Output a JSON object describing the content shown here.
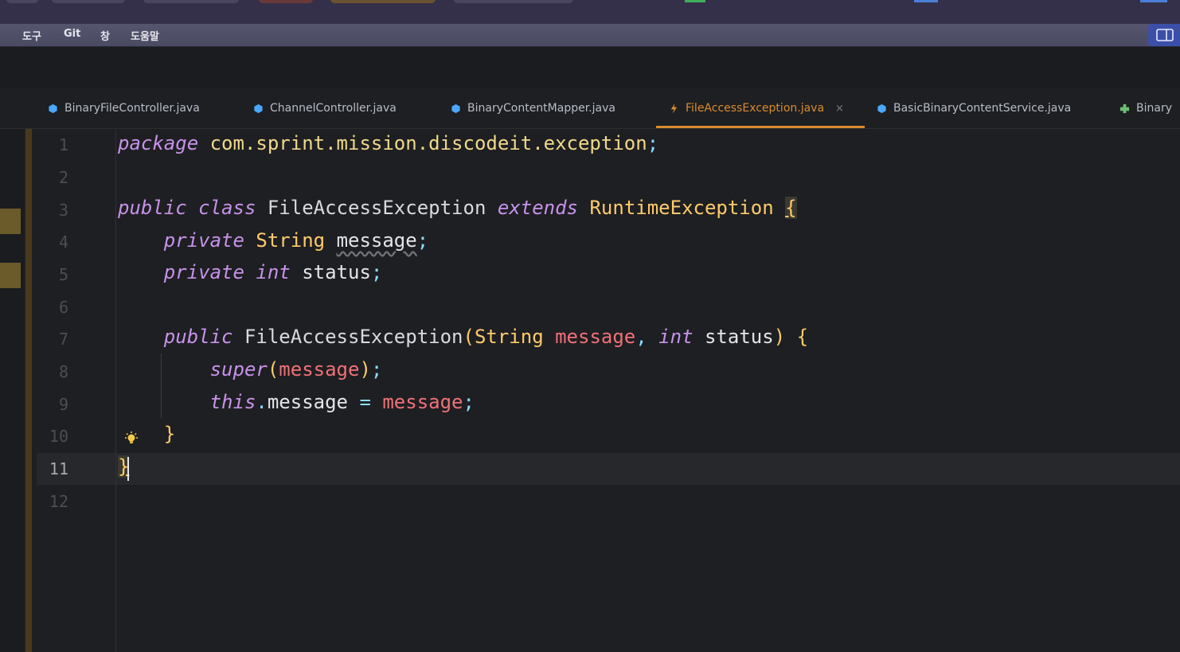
{
  "menu": {
    "items": [
      "도구",
      "Git",
      "창",
      "도움말"
    ]
  },
  "tabs": [
    {
      "label": "BinaryFileController.java",
      "icon": "class-icon",
      "icon_color": "#4aa8ff"
    },
    {
      "label": "ChannelController.java",
      "icon": "class-icon",
      "icon_color": "#4aa8ff"
    },
    {
      "label": "BinaryContentMapper.java",
      "icon": "class-icon",
      "icon_color": "#4aa8ff"
    },
    {
      "label": "FileAccessException.java",
      "icon": "exception-icon",
      "icon_color": "#d98b2f",
      "active": true,
      "close": "×"
    },
    {
      "label": "BasicBinaryContentService.java",
      "icon": "class-icon",
      "icon_color": "#4aa8ff"
    },
    {
      "label": "Binary",
      "icon": "package-icon",
      "icon_color": "#6fbf73"
    }
  ],
  "editor": {
    "line_numbers": [
      "1",
      "2",
      "3",
      "4",
      "5",
      "6",
      "7",
      "8",
      "9",
      "10",
      "11",
      "12"
    ],
    "current_line": "11",
    "tokens": {
      "l1_kw": "package",
      "l1_pkg": "com.sprint.mission.discodeit.exception",
      "l1_semi": ";",
      "l3_public": "public",
      "l3_class": "class",
      "l3_name": "FileAccessException",
      "l3_extends": "extends",
      "l3_super": "RuntimeException",
      "l3_brace": "{",
      "l4_private": "private",
      "l4_type": "String",
      "l4_field": "message",
      "l4_semi": ";",
      "l5_private": "private",
      "l5_type": "int",
      "l5_field": "status",
      "l5_semi": ";",
      "l7_public": "public",
      "l7_name": "FileAccessException",
      "l7_lparen": "(",
      "l7_type1": "String",
      "l7_p1": "message",
      "l7_comma": ",",
      "l7_type2": "int",
      "l7_p2": "status",
      "l7_rparen": ")",
      "l7_brace": "{",
      "l8_super": "super",
      "l8_lparen": "(",
      "l8_arg": "message",
      "l8_rparen": ")",
      "l8_semi": ";",
      "l9_this": "this",
      "l9_dot": ".",
      "l9_field": "message",
      "l9_eq": "=",
      "l9_val": "message",
      "l9_semi": ";",
      "l10_brace": "}",
      "l11_brace": "}"
    }
  },
  "colors": {
    "accent": "#d98b2f",
    "keyword": "#c792ea",
    "type": "#ffcb6b",
    "parameter": "#f07178"
  }
}
